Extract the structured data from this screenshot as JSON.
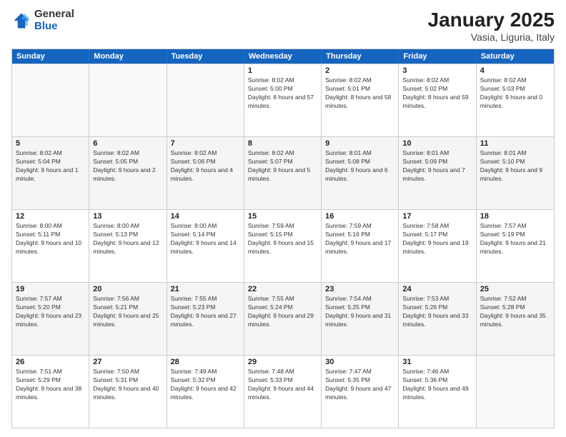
{
  "logo": {
    "general": "General",
    "blue": "Blue"
  },
  "title": "January 2025",
  "location": "Vasia, Liguria, Italy",
  "days": [
    "Sunday",
    "Monday",
    "Tuesday",
    "Wednesday",
    "Thursday",
    "Friday",
    "Saturday"
  ],
  "rows": [
    [
      {
        "day": "",
        "info": ""
      },
      {
        "day": "",
        "info": ""
      },
      {
        "day": "",
        "info": ""
      },
      {
        "day": "1",
        "info": "Sunrise: 8:02 AM\nSunset: 5:00 PM\nDaylight: 8 hours and 57 minutes."
      },
      {
        "day": "2",
        "info": "Sunrise: 8:02 AM\nSunset: 5:01 PM\nDaylight: 8 hours and 58 minutes."
      },
      {
        "day": "3",
        "info": "Sunrise: 8:02 AM\nSunset: 5:02 PM\nDaylight: 8 hours and 59 minutes."
      },
      {
        "day": "4",
        "info": "Sunrise: 8:02 AM\nSunset: 5:03 PM\nDaylight: 9 hours and 0 minutes."
      }
    ],
    [
      {
        "day": "5",
        "info": "Sunrise: 8:02 AM\nSunset: 5:04 PM\nDaylight: 9 hours and 1 minute."
      },
      {
        "day": "6",
        "info": "Sunrise: 8:02 AM\nSunset: 5:05 PM\nDaylight: 9 hours and 2 minutes."
      },
      {
        "day": "7",
        "info": "Sunrise: 8:02 AM\nSunset: 5:06 PM\nDaylight: 9 hours and 4 minutes."
      },
      {
        "day": "8",
        "info": "Sunrise: 8:02 AM\nSunset: 5:07 PM\nDaylight: 9 hours and 5 minutes."
      },
      {
        "day": "9",
        "info": "Sunrise: 8:01 AM\nSunset: 5:08 PM\nDaylight: 9 hours and 6 minutes."
      },
      {
        "day": "10",
        "info": "Sunrise: 8:01 AM\nSunset: 5:09 PM\nDaylight: 9 hours and 7 minutes."
      },
      {
        "day": "11",
        "info": "Sunrise: 8:01 AM\nSunset: 5:10 PM\nDaylight: 9 hours and 9 minutes."
      }
    ],
    [
      {
        "day": "12",
        "info": "Sunrise: 8:00 AM\nSunset: 5:11 PM\nDaylight: 9 hours and 10 minutes."
      },
      {
        "day": "13",
        "info": "Sunrise: 8:00 AM\nSunset: 5:13 PM\nDaylight: 9 hours and 12 minutes."
      },
      {
        "day": "14",
        "info": "Sunrise: 8:00 AM\nSunset: 5:14 PM\nDaylight: 9 hours and 14 minutes."
      },
      {
        "day": "15",
        "info": "Sunrise: 7:59 AM\nSunset: 5:15 PM\nDaylight: 9 hours and 15 minutes."
      },
      {
        "day": "16",
        "info": "Sunrise: 7:59 AM\nSunset: 5:16 PM\nDaylight: 9 hours and 17 minutes."
      },
      {
        "day": "17",
        "info": "Sunrise: 7:58 AM\nSunset: 5:17 PM\nDaylight: 9 hours and 19 minutes."
      },
      {
        "day": "18",
        "info": "Sunrise: 7:57 AM\nSunset: 5:19 PM\nDaylight: 9 hours and 21 minutes."
      }
    ],
    [
      {
        "day": "19",
        "info": "Sunrise: 7:57 AM\nSunset: 5:20 PM\nDaylight: 9 hours and 23 minutes."
      },
      {
        "day": "20",
        "info": "Sunrise: 7:56 AM\nSunset: 5:21 PM\nDaylight: 9 hours and 25 minutes."
      },
      {
        "day": "21",
        "info": "Sunrise: 7:55 AM\nSunset: 5:23 PM\nDaylight: 9 hours and 27 minutes."
      },
      {
        "day": "22",
        "info": "Sunrise: 7:55 AM\nSunset: 5:24 PM\nDaylight: 9 hours and 29 minutes."
      },
      {
        "day": "23",
        "info": "Sunrise: 7:54 AM\nSunset: 5:25 PM\nDaylight: 9 hours and 31 minutes."
      },
      {
        "day": "24",
        "info": "Sunrise: 7:53 AM\nSunset: 5:26 PM\nDaylight: 9 hours and 33 minutes."
      },
      {
        "day": "25",
        "info": "Sunrise: 7:52 AM\nSunset: 5:28 PM\nDaylight: 9 hours and 35 minutes."
      }
    ],
    [
      {
        "day": "26",
        "info": "Sunrise: 7:51 AM\nSunset: 5:29 PM\nDaylight: 9 hours and 38 minutes."
      },
      {
        "day": "27",
        "info": "Sunrise: 7:50 AM\nSunset: 5:31 PM\nDaylight: 9 hours and 40 minutes."
      },
      {
        "day": "28",
        "info": "Sunrise: 7:49 AM\nSunset: 5:32 PM\nDaylight: 9 hours and 42 minutes."
      },
      {
        "day": "29",
        "info": "Sunrise: 7:48 AM\nSunset: 5:33 PM\nDaylight: 9 hours and 44 minutes."
      },
      {
        "day": "30",
        "info": "Sunrise: 7:47 AM\nSunset: 5:35 PM\nDaylight: 9 hours and 47 minutes."
      },
      {
        "day": "31",
        "info": "Sunrise: 7:46 AM\nSunset: 5:36 PM\nDaylight: 9 hours and 49 minutes."
      },
      {
        "day": "",
        "info": ""
      }
    ]
  ]
}
